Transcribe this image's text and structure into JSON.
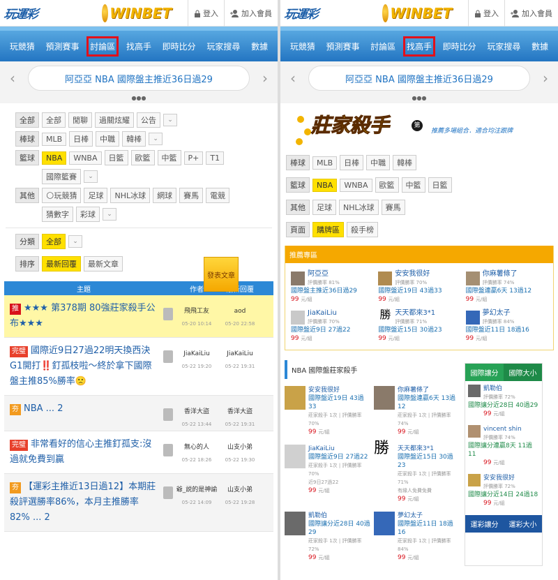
{
  "header": {
    "logo_left": "玩運彩",
    "logo_right": "WINBET",
    "login": "登入",
    "join": "加入會員"
  },
  "left": {
    "nav": [
      "玩競猜",
      "預測賽事",
      "討論區",
      "找高手",
      "即時比分",
      "玩家搜尋",
      "數據"
    ],
    "banner": "阿亞亞 NBA 國際盤主推近36日過29",
    "filters": {
      "all": {
        "label": "全部",
        "tags": [
          "全部",
          "閒聊",
          "過關炫耀",
          "公告"
        ]
      },
      "baseball": {
        "label": "棒球",
        "tags": [
          "MLB",
          "日棒",
          "中職",
          "韓棒"
        ]
      },
      "basketball": {
        "label": "籃球",
        "tags": [
          "NBA",
          "WNBA",
          "日籃",
          "歐籃",
          "中籃",
          "P+",
          "T1"
        ],
        "extra": "國際籃賽"
      },
      "other": {
        "label": "其他",
        "tags": [
          "玩競猜",
          "足球",
          "NHL冰球",
          "網球",
          "賽馬",
          "電競"
        ],
        "tags2": [
          "猜數字",
          "彩球"
        ]
      },
      "category": {
        "label": "分類",
        "tags": [
          "全部"
        ]
      },
      "sort": {
        "label": "排序",
        "tags": [
          "最新回覆",
          "最新文章"
        ]
      },
      "post_button": "發表文章"
    },
    "table": {
      "headers": [
        "主題",
        "作者",
        "最新回覆"
      ],
      "rows": [
        {
          "badge": "推",
          "title": "★★★ 第378期 80強莊家殺手公布★★★",
          "author": "飛飛工友",
          "adate": "05-20 10:14",
          "reply": "aod",
          "rdate": "05-20 22:58"
        },
        {
          "badge": "完璧",
          "title": "國際近9日27過22明天換西決G1開打‼️釘孤枝啦～終於拿下國際盤主推85%勝率🙁",
          "author": "JiaKaiLiu",
          "adate": "05-22 19:20",
          "reply": "JiaKaiLiu",
          "rdate": "05-22 19:31"
        },
        {
          "badge": "夯",
          "title": "NBA ... 2",
          "author": "香洋大盜",
          "adate": "05-22 13:44",
          "reply": "香洋大盜",
          "rdate": "05-22 19:31"
        },
        {
          "badge": "完璧",
          "title": "非常看好的信心主推釘孤支:沒過就免費到贏",
          "author": "無心的人",
          "adate": "05-22 18:26",
          "reply": "山支小弟",
          "rdate": "05-22 19:30"
        },
        {
          "badge": "夯",
          "title": "【運彩主推近13日過12】本期莊殺評選勝率86%，本月主推勝率82% ... 2",
          "author": "爺_説的是神諭",
          "adate": "05-22 14:09",
          "reply": "山支小弟",
          "rdate": "05-22 19:28"
        }
      ]
    }
  },
  "right": {
    "nav": [
      "玩競猜",
      "預測賽事",
      "討論區",
      "找高手",
      "即時比分",
      "玩家搜尋",
      "數據"
    ],
    "banner": "阿亞亞 NBA 國際盤主推近36日過29",
    "shark_title": "莊家殺手",
    "shark_badge": "第",
    "shark_sub": "推薦多場組合．適合均注跟牌",
    "filters": {
      "baseball": {
        "label": "棒球",
        "tags": [
          "MLB",
          "日棒",
          "中職",
          "韓棒"
        ]
      },
      "basketball": {
        "label": "籃球",
        "tags": [
          "NBA",
          "WNBA",
          "歐籃",
          "中籃",
          "日籃"
        ]
      },
      "other": {
        "label": "其他",
        "tags": [
          "足球",
          "NHL冰球",
          "賽馬"
        ]
      },
      "page": {
        "label": "頁面",
        "tags": [
          "購牌區",
          "殺手榜"
        ]
      }
    },
    "recommend": {
      "title": "推薦專區",
      "experts": [
        {
          "name": "阿亞亞",
          "sub": "評價勝率 81%",
          "rec": "國際盤主推近36日過29",
          "price": "99",
          "unit": "元/組"
        },
        {
          "name": "安安我很好",
          "sub": "評價勝率 70%",
          "rec": "國際盤近19日 43過33",
          "price": "99",
          "unit": "元/組"
        },
        {
          "name": "你麻薯條了",
          "sub": "評價勝率 74%",
          "rec": "國際盤連贏6天 13過12",
          "price": "99",
          "unit": "元/組"
        },
        {
          "name": "JiaKaiLiu",
          "sub": "評價勝率 70%",
          "rec": "國際盤近9日 27過22",
          "price": "99",
          "unit": "元/組"
        },
        {
          "name": "天天都來3*1",
          "sub": "評價勝率 71%",
          "rec": "國際盤近15日 30過23",
          "price": "99",
          "unit": "元/組"
        },
        {
          "name": "夢幻太子",
          "sub": "評價勝率 84%",
          "rec": "國際盤近11日 18過16",
          "price": "99",
          "unit": "元/組"
        }
      ]
    },
    "nba_section": {
      "title": "NBA 國際盤莊家殺手",
      "experts": [
        {
          "name": "安安我很好",
          "rec": "國際盤近19日 43過33",
          "sub": "莊家殺手 1次",
          "rate": "評價勝率 70%",
          "price": "99",
          "unit": "元/組"
        },
        {
          "name": "你麻薯條了",
          "rec": "國際盤連贏6天 13過12",
          "sub": "莊家殺手 1次",
          "rate": "評價勝率 74%",
          "price": "99",
          "unit": "元/組"
        },
        {
          "name": "JiaKaiLiu",
          "rec": "國際盤近9日 27過22",
          "sub": "莊家殺手 1次",
          "rate": "評價勝率 70%",
          "price": "99",
          "unit": "元/組",
          "extra": "近9日27過22"
        },
        {
          "name": "天天都來3*1",
          "rec": "國際盤近15日 30過23",
          "sub": "莊家殺手 1次",
          "rate": "評價勝率 71%",
          "price": "99",
          "unit": "元/組",
          "extra": "有緣人免費免費"
        },
        {
          "name": "凱勒伯",
          "rec": "國際讓分近28日 40過29",
          "sub": "莊家殺手 1次",
          "rate": "評價勝率 72%",
          "price": "99",
          "unit": "元/組"
        },
        {
          "name": "夢幻太子",
          "rec": "國際盤近11日 18過16",
          "sub": "莊家殺手 1次",
          "rate": "評價勝率 84%",
          "price": "99",
          "unit": "元/組"
        }
      ]
    },
    "side": {
      "tabs": [
        "國際讓分",
        "國際大小"
      ],
      "items": [
        {
          "name": "凱勒伯",
          "rate": "評價勝率 72%",
          "rec": "國際讓分近28日 40過29",
          "price": "99",
          "unit": "元/組"
        },
        {
          "name": "vincent shin",
          "rate": "評價勝率 74%",
          "rec": "國際讓分連贏8天 11過11",
          "price": "99",
          "unit": "元/組"
        },
        {
          "name": "安安我很好",
          "rate": "評價勝率 72%",
          "rec": "國際讓分近14日 24過18",
          "price": "99",
          "unit": "元/組"
        }
      ],
      "lottery_tabs": [
        "運彩讓分",
        "運彩大小"
      ]
    }
  }
}
